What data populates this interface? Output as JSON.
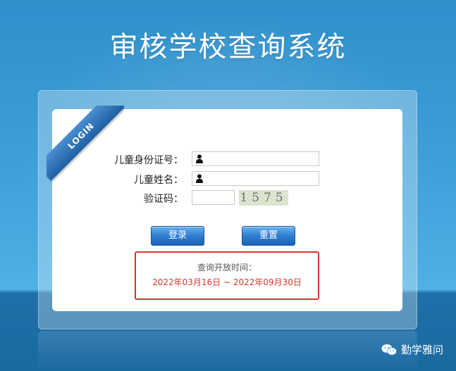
{
  "page": {
    "title": "审核学校查询系统"
  },
  "login_badge": {
    "text": "LOGIN"
  },
  "form": {
    "id_label": "儿童身份证号：",
    "id_value": "",
    "name_label": "儿童姓名：",
    "name_value": "",
    "captcha_label": "验证码：",
    "captcha_value": "",
    "captcha_code": "1575"
  },
  "buttons": {
    "login": "登录",
    "reset": "重置"
  },
  "notice": {
    "title": "查询开放时间：",
    "range": "2022年03月16日 ~ 2022年09月30日"
  },
  "watermark": {
    "text": "勤学雅问"
  },
  "colors": {
    "background": "#3da0d8",
    "button": "#2e7dd0",
    "notice_border": "#d9352c"
  }
}
